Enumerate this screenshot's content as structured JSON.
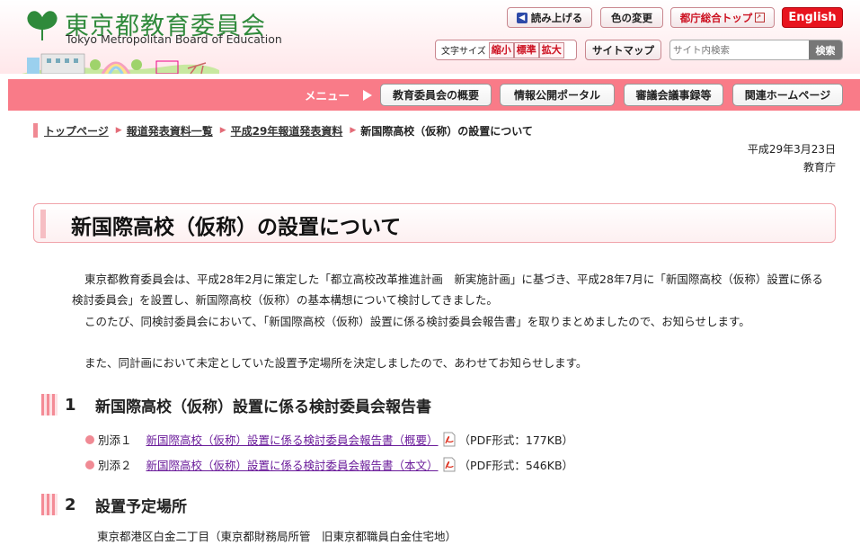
{
  "header": {
    "logo_title": "東京都教育委員会",
    "logo_subtitle": "Tokyo Metropolitan Board of Education",
    "read_aloud": "読み上げる",
    "color_change": "色の変更",
    "metro_top": "都庁総合トップ",
    "english": "English",
    "font_size_label": "文字サイズ",
    "font_small": "縮小",
    "font_standard": "標準",
    "font_large": "拡大",
    "sitemap": "サイトマップ",
    "search_placeholder": "サイト内検索",
    "search_button": "検索"
  },
  "nav": {
    "menu_label": "メニュー",
    "items": [
      "教育委員会の概要",
      "情報公開ポータル",
      "審議会議事録等",
      "関連ホームページ"
    ]
  },
  "breadcrumb": [
    "トップページ",
    "報道発表資料一覧",
    "平成29年報道発表資料",
    "新国際高校（仮称）の設置について"
  ],
  "date": "平成29年3月23日",
  "organization": "教育庁",
  "title": "新国際高校（仮称）の設置について",
  "paragraphs": [
    "東京都教育委員会は、平成28年2月に策定した「都立高校改革推進計画　新実施計画」に基づき、平成28年7月に「新国際高校（仮称）設置に係る検討委員会」を設置し、新国際高校（仮称）の基本構想について検討してきました。",
    "このたび、同検討委員会において、「新国際高校（仮称）設置に係る検討委員会報告書」を取りまとめましたので、お知らせします。",
    "また、同計画において未定としていた設置予定場所を決定しましたので、あわせてお知らせします。"
  ],
  "sections": [
    {
      "number": "1",
      "title": "新国際高校（仮称）設置に係る検討委員会報告書"
    },
    {
      "number": "2",
      "title": "設置予定場所"
    }
  ],
  "attachments": [
    {
      "label": "別添１",
      "link": "新国際高校（仮称）設置に係る検討委員会報告書（概要）",
      "info": "（PDF形式：177KB）"
    },
    {
      "label": "別添２",
      "link": "新国際高校（仮称）設置に係る検討委員会報告書（本文）",
      "info": "（PDF形式：546KB）"
    }
  ],
  "location": "東京都港区白金二丁目（東京都財務局所管　旧東京都職員白金住宅地）",
  "colors": {
    "accent": "#f97b88",
    "logo_green": "#2f8a3b",
    "english_red": "#e8141e",
    "link": "#6a1b9a"
  },
  "icons": [
    "ginkgo-logo-icon",
    "speaker-icon",
    "external-link-icon",
    "pdf-icon"
  ]
}
